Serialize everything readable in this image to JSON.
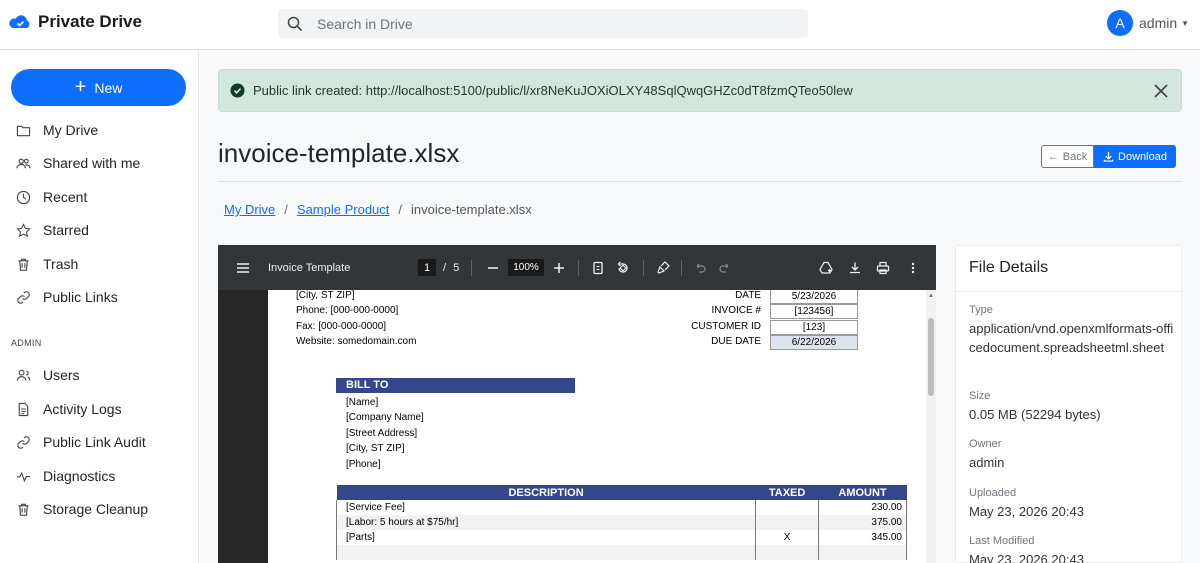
{
  "header": {
    "app_title": "Private Drive",
    "search_placeholder": "Search in Drive",
    "user_initial": "A",
    "user_name": "admin"
  },
  "sidebar": {
    "new_label": "New",
    "items": [
      {
        "label": "My Drive",
        "icon": "folder-icon"
      },
      {
        "label": "Shared with me",
        "icon": "people-icon"
      },
      {
        "label": "Recent",
        "icon": "clock-icon"
      },
      {
        "label": "Starred",
        "icon": "star-icon"
      },
      {
        "label": "Trash",
        "icon": "trash-icon"
      },
      {
        "label": "Public Links",
        "icon": "link-icon"
      }
    ],
    "admin_label": "ADMIN",
    "admin_items": [
      {
        "label": "Users",
        "icon": "users-icon"
      },
      {
        "label": "Activity Logs",
        "icon": "document-icon"
      },
      {
        "label": "Public Link Audit",
        "icon": "link-icon"
      },
      {
        "label": "Diagnostics",
        "icon": "pulse-icon"
      },
      {
        "label": "Storage Cleanup",
        "icon": "trash-icon"
      }
    ]
  },
  "alert": {
    "text": "Public link created: http://localhost:5100/public/l/xr8NeKuJOXiOLXY48SqlQwqGHZc0dT8fzmQTeo50lew"
  },
  "file": {
    "title": "invoice-template.xlsx",
    "back_label": "Back",
    "download_label": "Download"
  },
  "breadcrumb": {
    "items": [
      "My Drive",
      "Sample Product"
    ],
    "current": "invoice-template.xlsx",
    "separator": "/"
  },
  "viewer": {
    "doc_title": "Invoice Template",
    "page_current": "1",
    "page_sep": "/",
    "page_total": "5",
    "zoom": "100%"
  },
  "invoice": {
    "address_lines": [
      "[City, ST  ZIP]",
      "Phone: [000-000-0000]",
      "Fax: [000-000-0000]",
      "Website: somedomain.com"
    ],
    "meta": [
      {
        "label": "DATE",
        "value": "5/23/2026"
      },
      {
        "label": "INVOICE #",
        "value": "[123456]"
      },
      {
        "label": "CUSTOMER ID",
        "value": "[123]"
      },
      {
        "label": "DUE DATE",
        "value": "6/22/2026"
      }
    ],
    "bill_to_label": "BILL TO",
    "bill_to_lines": [
      "[Name]",
      "[Company Name]",
      "[Street Address]",
      "[City, ST  ZIP]",
      "[Phone]"
    ],
    "table_headers": [
      "DESCRIPTION",
      "TAXED",
      "AMOUNT"
    ],
    "rows": [
      {
        "desc": "[Service Fee]",
        "taxed": "",
        "amount": "230.00"
      },
      {
        "desc": "[Labor: 5 hours at $75/hr]",
        "taxed": "",
        "amount": "375.00"
      },
      {
        "desc": "[Parts]",
        "taxed": "X",
        "amount": "345.00"
      },
      {
        "desc": "",
        "taxed": "",
        "amount": ""
      }
    ]
  },
  "details": {
    "heading": "File Details",
    "type_label": "Type",
    "type_value": "application/vnd.openxmlformats-officedocument.spreadsheetml.sheet",
    "size_label": "Size",
    "size_value": "0.05 MB (52294 bytes)",
    "owner_label": "Owner",
    "owner_value": "admin",
    "uploaded_label": "Uploaded",
    "uploaded_value": "May 23, 2026 20:43",
    "modified_label": "Last Modified",
    "modified_value": "May 23, 2026 20:43"
  },
  "colors": {
    "primary": "#0d6efd",
    "alert_bg": "#d1e7dd",
    "invoice_header": "#33478a",
    "due_date_bg": "#dde3f0"
  }
}
